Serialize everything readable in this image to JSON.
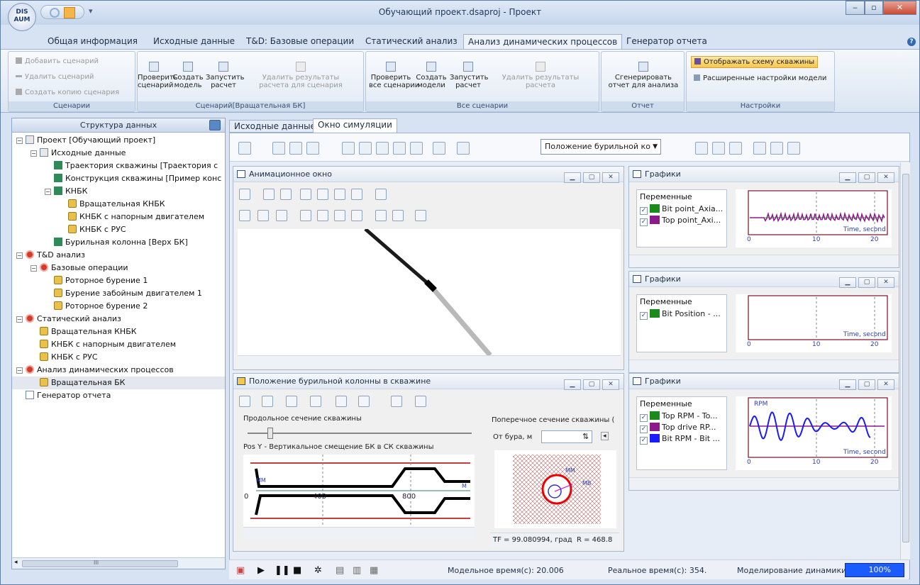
{
  "window": {
    "title": "Обучающий проект.dsaproj - Проект",
    "logo_text": "DIS AUM",
    "controls": [
      "‒",
      "▫",
      "✕"
    ]
  },
  "menu_tabs": [
    "Общая информация",
    "Исходные данные",
    "T&D: Базовые операции",
    "Статический анализ",
    "Анализ динамических процессов",
    "Генератор отчета"
  ],
  "active_menu_tab": "Анализ динамических процессов",
  "ribbon": {
    "groups": [
      {
        "label": "Сценарии",
        "rows": [
          "Добавить сценарий",
          "Удалить сценарий",
          "Создать копию сценария"
        ]
      },
      {
        "label": "Сценарий[Вращательная БК]",
        "items": [
          "Проверить\nсценарий",
          "Создать\nмодель",
          "Запустить\nрасчет",
          "Удалить результаты\nрасчета для сценария"
        ]
      },
      {
        "label": "Все сценарии",
        "items": [
          "Проверить\nвсе сценарии",
          "Создать\nмодели",
          "Запустить\nрасчет",
          "Удалить результаты\nрасчета"
        ]
      },
      {
        "label": "Отчет",
        "items": [
          "Сгенерировать\nотчет для анализа"
        ]
      },
      {
        "label": "Настройки",
        "rows": [
          "Отображать схему скважины",
          "Расширенные настройки модели"
        ]
      }
    ]
  },
  "left_panel": {
    "title": "Структура данных",
    "tree": [
      {
        "label": "Проект [Обучающий проект]",
        "level": 0,
        "icon": "folder",
        "exp": "−"
      },
      {
        "label": "Исходные данные",
        "level": 1,
        "icon": "folder",
        "exp": "−"
      },
      {
        "label": "Траектория скважины [Траектория с",
        "level": 2,
        "icon": "kn"
      },
      {
        "label": "Конструкция скважины [Пример конс",
        "level": 2,
        "icon": "kn"
      },
      {
        "label": "КНБК",
        "level": 2,
        "icon": "kn",
        "exp": "−"
      },
      {
        "label": "Вращательная КНБК",
        "level": 3,
        "icon": "lock"
      },
      {
        "label": "КНБК с напорным двигателем",
        "level": 3,
        "icon": "lock"
      },
      {
        "label": "КНБК с РУС",
        "level": 3,
        "icon": "lock"
      },
      {
        "label": "Бурильная колонна [Верх БК]",
        "level": 2,
        "icon": "kn"
      },
      {
        "label": "T&D анализ",
        "level": 0,
        "icon": "red",
        "exp": "−"
      },
      {
        "label": "Базовые операции",
        "level": 1,
        "icon": "red",
        "exp": "−"
      },
      {
        "label": "Роторное бурение 1",
        "level": 2,
        "icon": "lock"
      },
      {
        "label": "Бурение забойным двигателем 1",
        "level": 2,
        "icon": "lock"
      },
      {
        "label": "Роторное бурение 2",
        "level": 2,
        "icon": "lock"
      },
      {
        "label": "Статический анализ",
        "level": 0,
        "icon": "red",
        "exp": "−"
      },
      {
        "label": "Вращательная КНБК",
        "level": 1,
        "icon": "lock"
      },
      {
        "label": "КНБК с напорным двигателем",
        "level": 1,
        "icon": "lock"
      },
      {
        "label": "КНБК с РУС",
        "level": 1,
        "icon": "lock"
      },
      {
        "label": "Анализ динамических процессов",
        "level": 0,
        "icon": "red",
        "exp": "−"
      },
      {
        "label": "Вращательная БК",
        "level": 1,
        "icon": "lock",
        "selected": true
      },
      {
        "label": "Генератор отчета",
        "level": 0,
        "icon": "rep"
      }
    ],
    "hscroll": "III"
  },
  "doc_tabs": [
    "Исходные данные",
    "Окно симуляции"
  ],
  "active_doc_tab": "Окно симуляции",
  "sim_toolbar": {
    "dropdown": "Положение бурильной ко"
  },
  "animation_window": {
    "title": "Анимационное окно"
  },
  "position_window": {
    "title": "Положение бурильной колонны в скважине",
    "long_section": "Продольное сечение скважины",
    "pos_label": "Pos Y - Вертикальное смещение БК в СК скважины",
    "cross_section": "Поперечное сечение скважины (",
    "from_bit": "От бура, м",
    "tf_text": "TF = 99.080994, град",
    "r_text": "R = 468.8",
    "axis_ticks": [
      "400",
      "800"
    ],
    "zero": "0",
    "mm_left": "MM",
    "m_right": "M",
    "mm_small": "MM",
    "mb_small": "MB"
  },
  "graph_windows": [
    {
      "title": "Графики",
      "vars_header": "Переменные",
      "vars": [
        {
          "name": "Bit point_Axia...",
          "color": "#1a8a1a"
        },
        {
          "name": "Top point_Axi...",
          "color": "#8b1a8b"
        }
      ],
      "x_label": "Time, second",
      "ticks": [
        "0",
        "10",
        "20"
      ]
    },
    {
      "title": "Графики",
      "vars_header": "Переменные",
      "vars": [
        {
          "name": "Bit Position - ...",
          "color": "#1a8a1a"
        }
      ],
      "x_label": "Time, second",
      "ticks": [
        "0",
        "10",
        "20"
      ]
    },
    {
      "title": "Графики",
      "vars_header": "Переменные",
      "vars": [
        {
          "name": "Top RPM - To...",
          "color": "#1a8a1a"
        },
        {
          "name": "Top drive RP...",
          "color": "#8b1a8b"
        },
        {
          "name": "Bit RPM - Bit ...",
          "color": "#1a1aff"
        }
      ],
      "x_label": "Time, second",
      "y_label": "RPM",
      "ticks": [
        "0",
        "10",
        "20"
      ]
    }
  ],
  "bottom_bar": {
    "model_time": "Модельное время(с): 20.006",
    "real_time": "Реальное время(с): 354.",
    "dyn_label": "Моделирование динамики:",
    "progress_text": "100%",
    "progress_value": 100
  }
}
